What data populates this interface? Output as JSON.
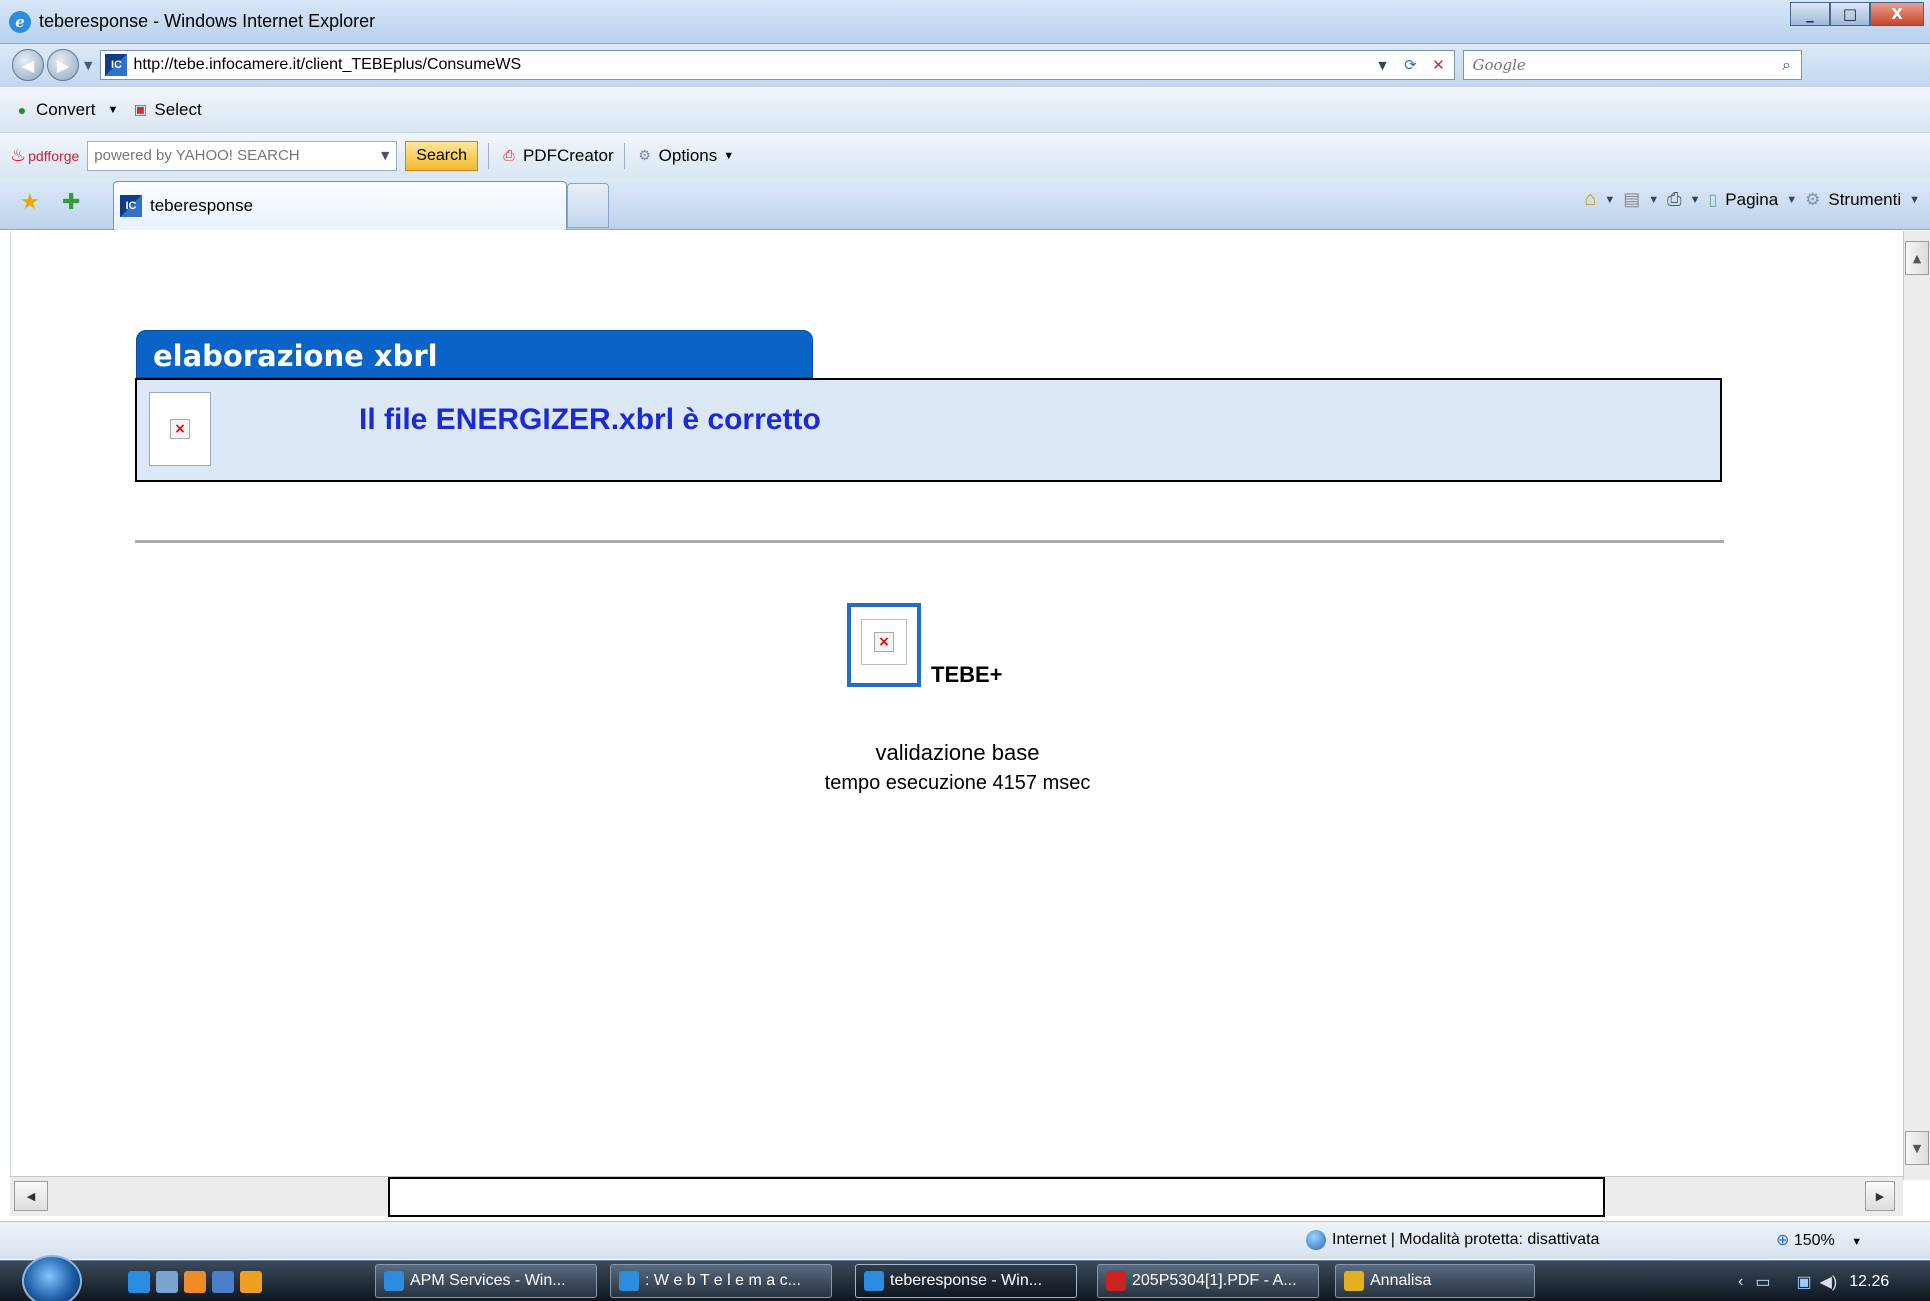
{
  "window": {
    "title": "teberesponse - Windows Internet Explorer",
    "min": "_",
    "max": "□",
    "close": "X"
  },
  "address": {
    "url": "http://tebe.infocamere.it/client_TEBEplus/ConsumeWS",
    "search_placeholder": "Google"
  },
  "command_bar": {
    "convert": "Convert",
    "select": "Select"
  },
  "pdf_toolbar": {
    "brand": "pdfforge",
    "search_placeholder": "powered by YAHOO! SEARCH",
    "search_button": "Search",
    "pdfcreator": "PDFCreator",
    "options": "Options"
  },
  "tab": {
    "label": "teberesponse"
  },
  "tools": {
    "pagina": "Pagina",
    "strumenti": "Strumenti"
  },
  "page": {
    "section_title": "elaborazione xbrl",
    "message": "Il file ENERGIZER.xbrl è corretto",
    "logo_text": "TEBE+",
    "validation": "validazione base",
    "exec_time": "tempo esecuzione 4157 msec"
  },
  "statusbar": {
    "zone": "Internet | Modalità protetta: disattivata",
    "zoom": "150%"
  },
  "taskbar": {
    "buttons": [
      "APM Services - Win...",
      ": W e b T e l e m a c...",
      "teberesponse - Win...",
      "205P5304[1].PDF - A...",
      "Annalisa"
    ],
    "clock": "12.26"
  },
  "colors": {
    "accent": "#0a64c8",
    "message": "#1a2ad6",
    "panel_bg": "#dde8f7"
  }
}
